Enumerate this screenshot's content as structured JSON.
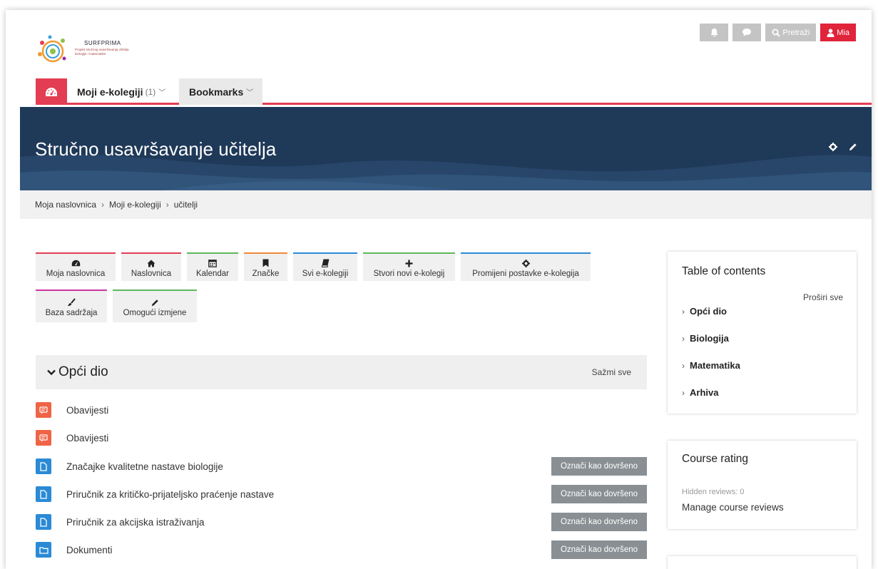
{
  "logo": {
    "title": "SURFPRIMA",
    "subtitle": "Projekt stručnog usavršavanja učitelja biologije i matematike"
  },
  "topbar": {
    "search_label": "Pretraži",
    "user_label": "Mia"
  },
  "nav": {
    "my_courses_label": "Moji e-kolegiji",
    "my_courses_count": "(1)",
    "bookmarks_label": "Bookmarks"
  },
  "banner": {
    "title": "Stručno usavršavanje učitelja"
  },
  "breadcrumb": [
    "Moja naslovnica",
    "Moji e-kolegiji",
    "učitelji"
  ],
  "quick_buttons": [
    {
      "label": "Moja naslovnica",
      "icon": "dashboard-icon",
      "color": "#e23d53"
    },
    {
      "label": "Naslovnica",
      "icon": "home-icon",
      "color": "#e23d53"
    },
    {
      "label": "Kalendar",
      "icon": "calendar-icon",
      "color": "#5cb85c"
    },
    {
      "label": "Značke",
      "icon": "bookmark-icon",
      "color": "#f0883a"
    },
    {
      "label": "Svi e-kolegiji",
      "icon": "book-icon",
      "color": "#2b8ad6"
    },
    {
      "label": "Stvori novi e-kolegij",
      "icon": "plus-icon",
      "color": "#5cb85c"
    },
    {
      "label": "Promijeni postavke e-kolegija",
      "icon": "gear-icon",
      "color": "#2b8ad6"
    },
    {
      "label": "Baza sadržaja",
      "icon": "brush-icon",
      "color": "#c9379e"
    },
    {
      "label": "Omogući izmjene",
      "icon": "pencil-icon",
      "color": "#5cb85c"
    }
  ],
  "section": {
    "title": "Opći dio",
    "collapse_label": "Sažmi sve",
    "activities": [
      {
        "label": "Obavijesti",
        "icon": "forum-icon",
        "color": "#ef6446"
      },
      {
        "label": "Obavijesti",
        "icon": "forum-icon",
        "color": "#ef6446"
      },
      {
        "label": "Značajke kvalitetne nastave biologije",
        "icon": "file-icon",
        "color": "#2b8ad6",
        "button": "Označi kao dovršeno"
      },
      {
        "label": "Priručnik za kritičko-prijateljsko praćenje nastave",
        "icon": "file-icon",
        "color": "#2b8ad6",
        "button": "Označi kao dovršeno"
      },
      {
        "label": "Priručnik za akcijska istraživanja",
        "icon": "file-icon",
        "color": "#2b8ad6",
        "button": "Označi kao dovršeno"
      },
      {
        "label": "Dokumenti",
        "icon": "folder-icon",
        "color": "#2b8ad6",
        "button": "Označi kao dovršeno"
      }
    ]
  },
  "toc": {
    "title": "Table of contents",
    "expand_label": "Proširi sve",
    "items": [
      "Opći dio",
      "Biologija",
      "Matematika",
      "Arhiva"
    ]
  },
  "rating": {
    "title": "Course rating",
    "hidden_reviews": "Hidden reviews: 0",
    "manage_label": "Manage course reviews"
  }
}
